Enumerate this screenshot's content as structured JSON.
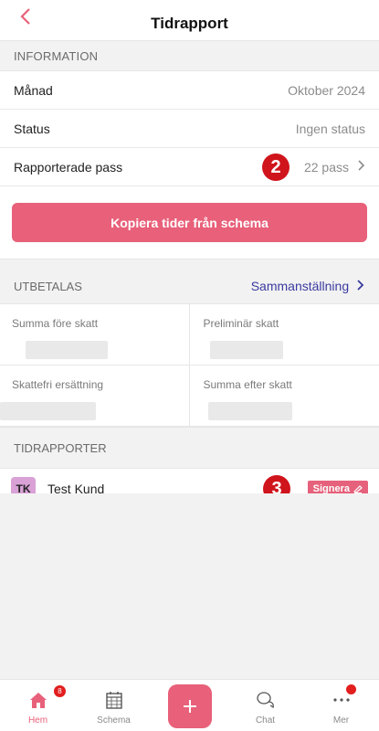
{
  "header": {
    "title": "Tidrapport",
    "back_icon": "chevron-left-icon"
  },
  "information": {
    "heading": "INFORMATION",
    "rows": [
      {
        "label": "Månad",
        "value": "Oktober 2024"
      },
      {
        "label": "Status",
        "value": "Ingen status"
      },
      {
        "label": "Rapporterade pass",
        "value": "22 pass"
      }
    ],
    "copy_button": "Kopiera tider från schema"
  },
  "markers": {
    "m2": "2",
    "m3": "3"
  },
  "utbetalas": {
    "heading": "UTBETALAS",
    "link": "Sammanställning",
    "cells": [
      "Summa före skatt",
      "Preliminär skatt",
      "Skattefri ersättning",
      "Summa efter skatt"
    ]
  },
  "tidrapporter": {
    "heading": "TIDRAPPORTER",
    "items": [
      {
        "initials": "TK",
        "name": "Test Kund",
        "action": "Signera"
      }
    ]
  },
  "tabbar": {
    "items": [
      {
        "label": "Hem",
        "icon": "home-icon",
        "badge": "8",
        "active": true
      },
      {
        "label": "Schema",
        "icon": "calendar-icon"
      },
      {
        "label": "",
        "icon": "plus-icon"
      },
      {
        "label": "Chat",
        "icon": "chat-icon"
      },
      {
        "label": "Mer",
        "icon": "more-icon",
        "badge": ""
      }
    ]
  },
  "colors": {
    "accent": "#e86079",
    "marker": "#d0141c",
    "link": "#3a3aa0"
  }
}
